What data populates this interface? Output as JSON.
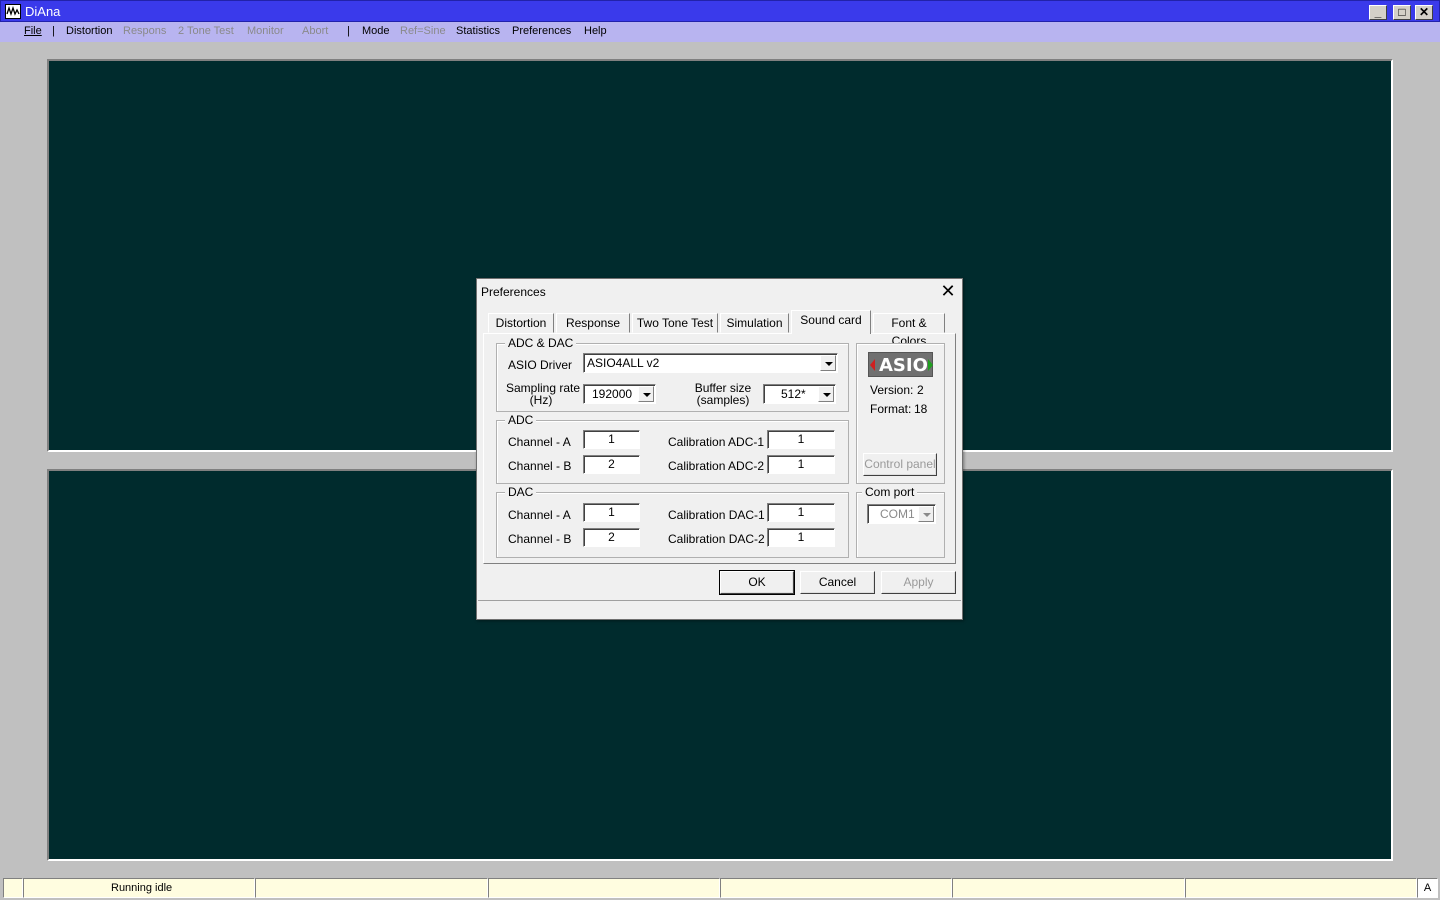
{
  "window": {
    "title": "DiAna",
    "controls": {
      "minimize": "_",
      "maximize": "□",
      "close": "✕"
    }
  },
  "menu": {
    "file": "File",
    "distortion": "Distortion",
    "respons": "Respons",
    "two_tone": "2 Tone Test",
    "monitor": "Monitor",
    "abort": "Abort",
    "mode": "Mode",
    "ref_sine": "Ref=Sine",
    "statistics": "Statistics",
    "preferences": "Preferences",
    "help": "Help",
    "separator": "|"
  },
  "status": {
    "running": "Running idle",
    "right": "A"
  },
  "dialog": {
    "title": "Preferences",
    "close": "✕",
    "tabs": [
      "Distortion",
      "Response",
      "Two Tone Test",
      "Simulation",
      "Sound card",
      "Font & Colors"
    ],
    "active_tab": "Sound card",
    "adc_dac": {
      "legend": "ADC & DAC",
      "driver_label": "ASIO Driver",
      "driver_value": "ASIO4ALL v2",
      "sampling_label_1": "Sampling rate",
      "sampling_label_2": "(Hz)",
      "sampling_value": "192000",
      "buffer_label_1": "Buffer size",
      "buffer_label_2": "(samples)",
      "buffer_value": "512*"
    },
    "adc": {
      "legend": "ADC",
      "channel_a_label": "Channel - A",
      "channel_a_value": "1",
      "channel_b_label": "Channel - B",
      "channel_b_value": "2",
      "cal1_label": "Calibration ADC-1",
      "cal1_value": "1",
      "cal2_label": "Calibration ADC-2",
      "cal2_value": "1"
    },
    "dac": {
      "legend": "DAC",
      "channel_a_label": "Channel - A",
      "channel_a_value": "1",
      "channel_b_label": "Channel - B",
      "channel_b_value": "2",
      "cal1_label": "Calibration DAC-1",
      "cal1_value": "1",
      "cal2_label": "Calibration DAC-2",
      "cal2_value": "1"
    },
    "asio": {
      "logo_text": "ASIO",
      "version_label": "Version:",
      "version_value": "2",
      "format_label": "Format:",
      "format_value": "18",
      "control_panel": "Control panel"
    },
    "com": {
      "legend": "Com port",
      "value": "COM1"
    },
    "buttons": {
      "ok": "OK",
      "cancel": "Cancel",
      "apply": "Apply"
    }
  }
}
